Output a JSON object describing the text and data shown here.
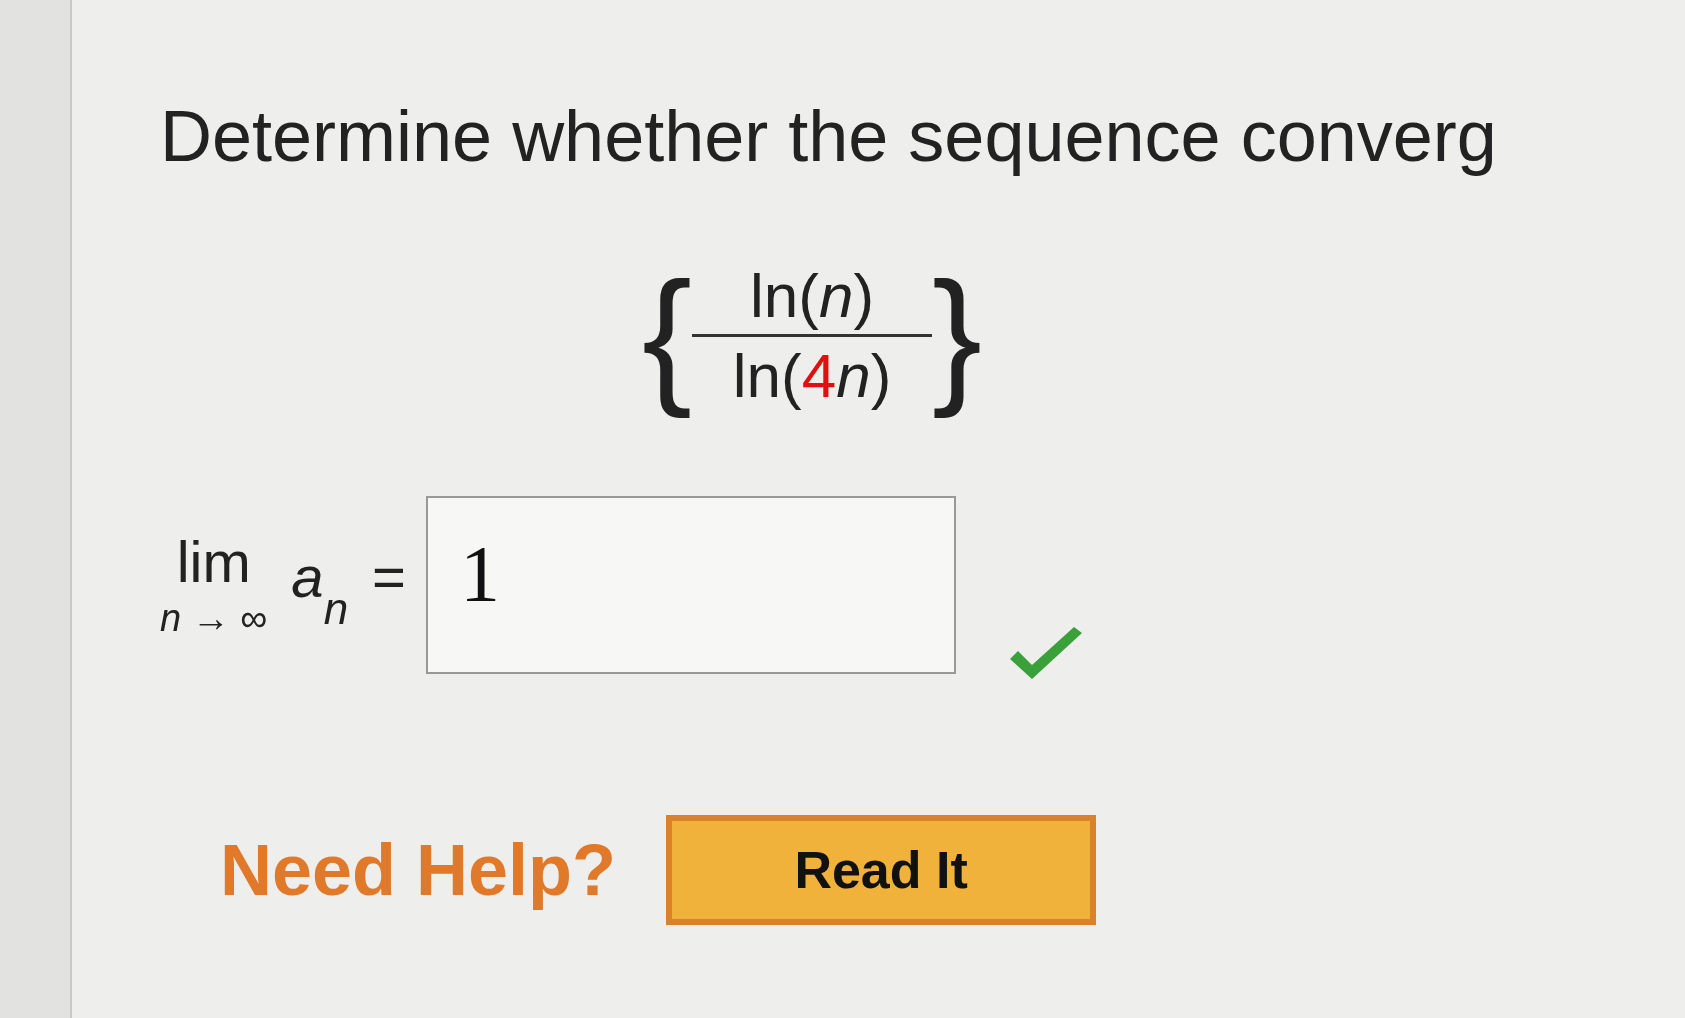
{
  "question": "Determine whether the sequence converg",
  "sequence": {
    "open_brace": "{",
    "numerator": "ln(*n*)",
    "denominator_before": "ln(",
    "denominator_highlight": "4",
    "denominator_after": "*n*)",
    "close_brace": "}"
  },
  "limit": {
    "operator": "lim",
    "subscript": "*n* → ∞",
    "term": "*a*",
    "term_index": "*n*",
    "equals": "="
  },
  "answer": {
    "value": "1",
    "correct": true
  },
  "help": {
    "label": "Need Help?",
    "buttons": [
      "Read It"
    ]
  }
}
